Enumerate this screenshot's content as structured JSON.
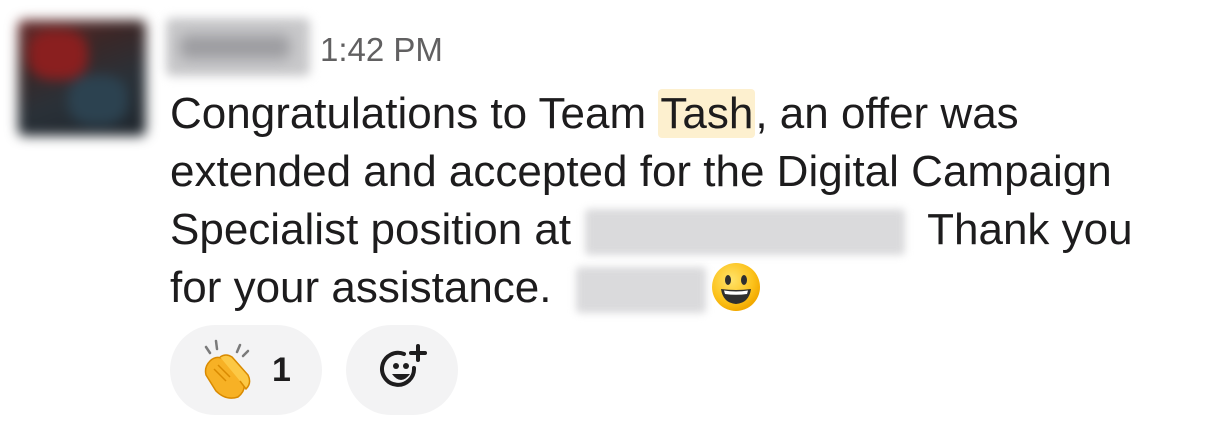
{
  "message": {
    "timestamp": "1:42 PM",
    "line1_pre": "Congratulations to Team ",
    "mention": "Tash",
    "line1_post": ", an offer was",
    "line2": "extended and accepted for the Digital Campaign",
    "line3_pre": "Specialist position at",
    "line3_post": "Thank you",
    "line4": "for your assistance.",
    "emoji": "smiley-face-icon"
  },
  "reactions": [
    {
      "icon": "clapping-hands-icon",
      "count": "1"
    },
    {
      "icon": "add-reaction-icon",
      "count": ""
    }
  ],
  "colors": {
    "mention_bg": "#fdf0cf",
    "reaction_bg": "#f3f3f4",
    "timestamp": "#616061",
    "text": "#1d1c1d"
  }
}
